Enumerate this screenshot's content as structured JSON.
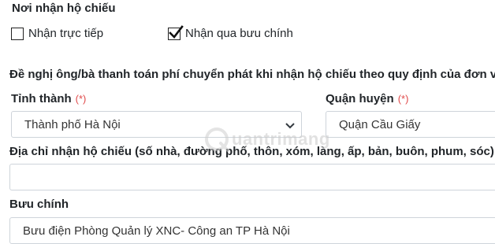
{
  "section": {
    "title": "Nơi nhận hộ chiếu"
  },
  "options": [
    {
      "label": "Nhận trực tiếp",
      "checked": false
    },
    {
      "label": "Nhận qua bưu chính",
      "checked": true
    }
  ],
  "notice": "Đề nghị ông/bà thanh toán phí chuyển phát khi nhận hộ chiếu theo quy định của đơn vị",
  "province": {
    "label": "Tỉnh thành",
    "required": "(*)",
    "value": "Thành phố Hà Nội"
  },
  "district": {
    "label": "Quận huyện",
    "required": "(*)",
    "value": "Quận Cầu Giấy"
  },
  "address": {
    "label": "Địa chỉ nhận hộ chiếu (số nhà, đường phố, thôn, xóm, làng, ấp, bản, buôn, phum, sóc)",
    "value": ""
  },
  "postal": {
    "label": "Bưu chính",
    "value": "Bưu điện Phòng Quản lý XNC- Công an TP Hà Nội"
  },
  "watermark": {
    "text": "uantrimang"
  },
  "colors": {
    "required": "#e04a4a",
    "border": "#ced4da"
  }
}
